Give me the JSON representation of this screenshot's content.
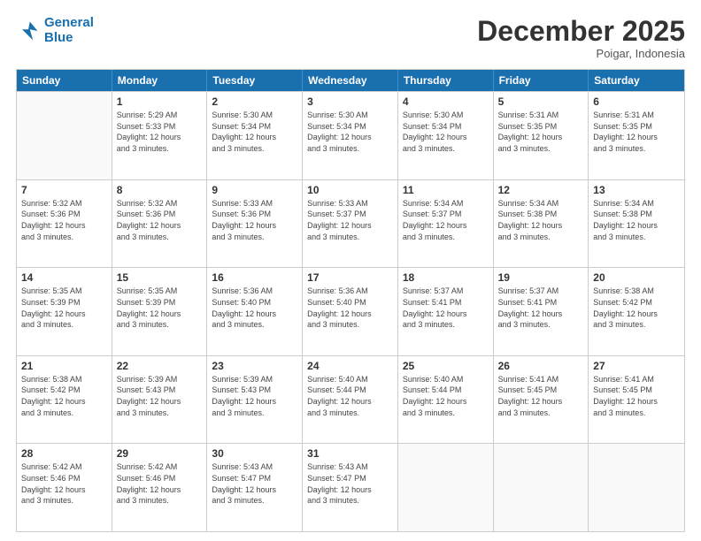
{
  "header": {
    "logo_line1": "General",
    "logo_line2": "Blue",
    "month": "December 2025",
    "location": "Poigar, Indonesia"
  },
  "weekdays": [
    "Sunday",
    "Monday",
    "Tuesday",
    "Wednesday",
    "Thursday",
    "Friday",
    "Saturday"
  ],
  "weeks": [
    [
      {
        "day": "",
        "info": ""
      },
      {
        "day": "1",
        "info": "Sunrise: 5:29 AM\nSunset: 5:33 PM\nDaylight: 12 hours\nand 3 minutes."
      },
      {
        "day": "2",
        "info": "Sunrise: 5:30 AM\nSunset: 5:34 PM\nDaylight: 12 hours\nand 3 minutes."
      },
      {
        "day": "3",
        "info": "Sunrise: 5:30 AM\nSunset: 5:34 PM\nDaylight: 12 hours\nand 3 minutes."
      },
      {
        "day": "4",
        "info": "Sunrise: 5:30 AM\nSunset: 5:34 PM\nDaylight: 12 hours\nand 3 minutes."
      },
      {
        "day": "5",
        "info": "Sunrise: 5:31 AM\nSunset: 5:35 PM\nDaylight: 12 hours\nand 3 minutes."
      },
      {
        "day": "6",
        "info": "Sunrise: 5:31 AM\nSunset: 5:35 PM\nDaylight: 12 hours\nand 3 minutes."
      }
    ],
    [
      {
        "day": "7",
        "info": "Sunrise: 5:32 AM\nSunset: 5:36 PM\nDaylight: 12 hours\nand 3 minutes."
      },
      {
        "day": "8",
        "info": "Sunrise: 5:32 AM\nSunset: 5:36 PM\nDaylight: 12 hours\nand 3 minutes."
      },
      {
        "day": "9",
        "info": "Sunrise: 5:33 AM\nSunset: 5:36 PM\nDaylight: 12 hours\nand 3 minutes."
      },
      {
        "day": "10",
        "info": "Sunrise: 5:33 AM\nSunset: 5:37 PM\nDaylight: 12 hours\nand 3 minutes."
      },
      {
        "day": "11",
        "info": "Sunrise: 5:34 AM\nSunset: 5:37 PM\nDaylight: 12 hours\nand 3 minutes."
      },
      {
        "day": "12",
        "info": "Sunrise: 5:34 AM\nSunset: 5:38 PM\nDaylight: 12 hours\nand 3 minutes."
      },
      {
        "day": "13",
        "info": "Sunrise: 5:34 AM\nSunset: 5:38 PM\nDaylight: 12 hours\nand 3 minutes."
      }
    ],
    [
      {
        "day": "14",
        "info": "Sunrise: 5:35 AM\nSunset: 5:39 PM\nDaylight: 12 hours\nand 3 minutes."
      },
      {
        "day": "15",
        "info": "Sunrise: 5:35 AM\nSunset: 5:39 PM\nDaylight: 12 hours\nand 3 minutes."
      },
      {
        "day": "16",
        "info": "Sunrise: 5:36 AM\nSunset: 5:40 PM\nDaylight: 12 hours\nand 3 minutes."
      },
      {
        "day": "17",
        "info": "Sunrise: 5:36 AM\nSunset: 5:40 PM\nDaylight: 12 hours\nand 3 minutes."
      },
      {
        "day": "18",
        "info": "Sunrise: 5:37 AM\nSunset: 5:41 PM\nDaylight: 12 hours\nand 3 minutes."
      },
      {
        "day": "19",
        "info": "Sunrise: 5:37 AM\nSunset: 5:41 PM\nDaylight: 12 hours\nand 3 minutes."
      },
      {
        "day": "20",
        "info": "Sunrise: 5:38 AM\nSunset: 5:42 PM\nDaylight: 12 hours\nand 3 minutes."
      }
    ],
    [
      {
        "day": "21",
        "info": "Sunrise: 5:38 AM\nSunset: 5:42 PM\nDaylight: 12 hours\nand 3 minutes."
      },
      {
        "day": "22",
        "info": "Sunrise: 5:39 AM\nSunset: 5:43 PM\nDaylight: 12 hours\nand 3 minutes."
      },
      {
        "day": "23",
        "info": "Sunrise: 5:39 AM\nSunset: 5:43 PM\nDaylight: 12 hours\nand 3 minutes."
      },
      {
        "day": "24",
        "info": "Sunrise: 5:40 AM\nSunset: 5:44 PM\nDaylight: 12 hours\nand 3 minutes."
      },
      {
        "day": "25",
        "info": "Sunrise: 5:40 AM\nSunset: 5:44 PM\nDaylight: 12 hours\nand 3 minutes."
      },
      {
        "day": "26",
        "info": "Sunrise: 5:41 AM\nSunset: 5:45 PM\nDaylight: 12 hours\nand 3 minutes."
      },
      {
        "day": "27",
        "info": "Sunrise: 5:41 AM\nSunset: 5:45 PM\nDaylight: 12 hours\nand 3 minutes."
      }
    ],
    [
      {
        "day": "28",
        "info": "Sunrise: 5:42 AM\nSunset: 5:46 PM\nDaylight: 12 hours\nand 3 minutes."
      },
      {
        "day": "29",
        "info": "Sunrise: 5:42 AM\nSunset: 5:46 PM\nDaylight: 12 hours\nand 3 minutes."
      },
      {
        "day": "30",
        "info": "Sunrise: 5:43 AM\nSunset: 5:47 PM\nDaylight: 12 hours\nand 3 minutes."
      },
      {
        "day": "31",
        "info": "Sunrise: 5:43 AM\nSunset: 5:47 PM\nDaylight: 12 hours\nand 3 minutes."
      },
      {
        "day": "",
        "info": ""
      },
      {
        "day": "",
        "info": ""
      },
      {
        "day": "",
        "info": ""
      }
    ]
  ]
}
